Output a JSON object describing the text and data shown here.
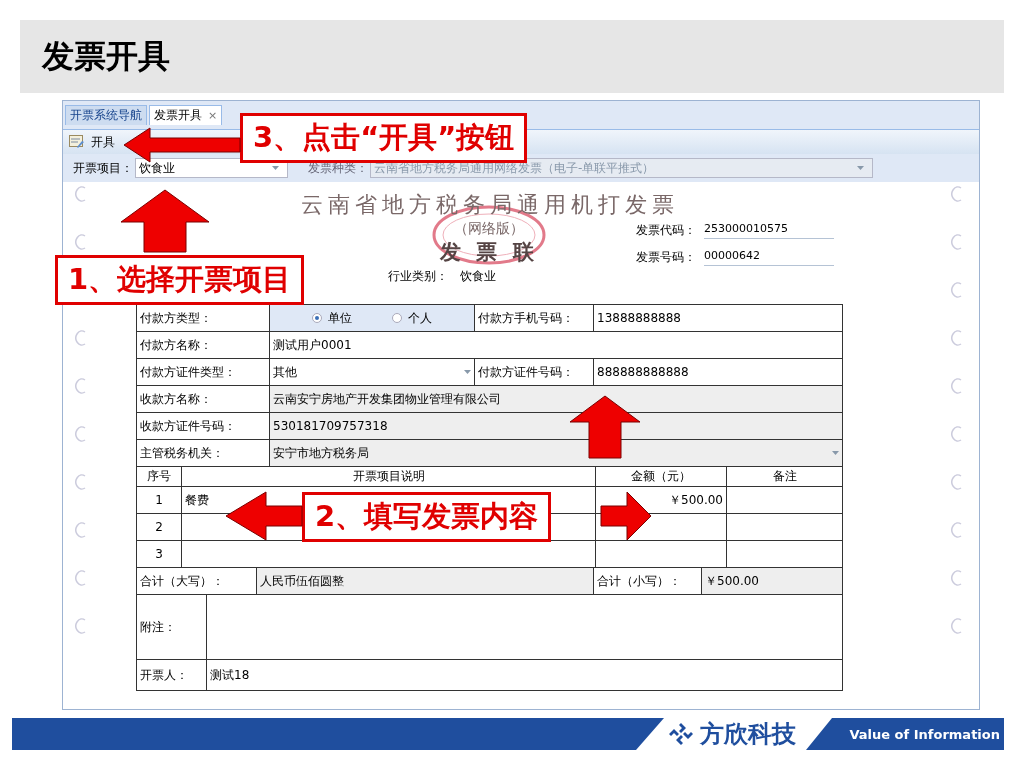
{
  "slide_title": "发票开具",
  "tabs": [
    {
      "label": "开票系统导航",
      "selected": false
    },
    {
      "label": "发票开具",
      "selected": true,
      "close": "×"
    }
  ],
  "toolbar": [
    {
      "label": "开具"
    }
  ],
  "filters": [
    {
      "label": "开票项目：",
      "value": "饮食业",
      "disabled": false
    },
    {
      "label": "发票种类：",
      "value": "云南省地方税务局通用网络发票（电子-单联平推式）",
      "disabled": true
    }
  ],
  "invoice": {
    "title": "云南省地方税务局通用机打发票",
    "edition": "（网络版）",
    "copy": "发 票 联",
    "code_label": "发票代码：",
    "code": "253000010575",
    "number_label": "发票号码：",
    "number": "00000642",
    "industry_label": "行业类别：",
    "industry": "饮食业"
  },
  "form": [
    {
      "kind": "radio",
      "label": "付款方类型：",
      "options": [
        {
          "label": "单位",
          "selected": true
        },
        {
          "label": "个人",
          "selected": false
        }
      ],
      "side_label": "付款方手机号码：",
      "side_value": "13888888888"
    },
    {
      "kind": "text",
      "label": "付款方名称：",
      "value": "测试用户0001",
      "readonly": false
    },
    {
      "kind": "select",
      "label": "付款方证件类型：",
      "value": "其他",
      "readonly": false,
      "side_label": "付款方证件号码：",
      "side_value": "888888888888"
    },
    {
      "kind": "text",
      "label": "收款方名称：",
      "value": "云南安宁房地产开发集团物业管理有限公司",
      "readonly": true
    },
    {
      "kind": "text",
      "label": "收款方证件号码：",
      "value": "530181709757318",
      "readonly": true
    },
    {
      "kind": "select",
      "label": "主管税务机关：",
      "value": "安宁市地方税务局",
      "readonly": true
    }
  ],
  "items": {
    "columns": [
      "序号",
      "开票项目说明",
      "金额（元）",
      "备注"
    ],
    "rows": [
      {
        "no": "1",
        "description": "餐费",
        "amount": "￥500.00"
      },
      {
        "no": "2"
      },
      {
        "no": "3"
      }
    ]
  },
  "totals": {
    "upper_label": "合计（大写）：",
    "upper": "人民币伍佰圆整",
    "lower_label": "合计（小写）：",
    "lower": "￥500.00"
  },
  "remark_label": "附注：",
  "issuer_label": "开票人：",
  "issuer": "测试18",
  "callouts": [
    {
      "text": "3、点击“开具”按钮"
    },
    {
      "text": "1、选择开票项目"
    },
    {
      "text": "2、填写发票内容"
    }
  ],
  "footer": {
    "brand": "方欣科技",
    "tagline": "Value of Information"
  }
}
